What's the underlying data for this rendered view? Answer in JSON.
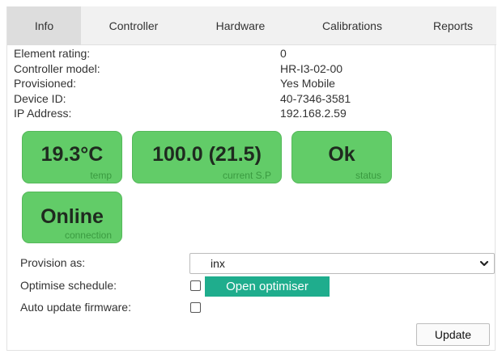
{
  "tabs": [
    {
      "label": "Info",
      "active": true
    },
    {
      "label": "Controller",
      "active": false
    },
    {
      "label": "Hardware",
      "active": false
    },
    {
      "label": "Calibrations",
      "active": false
    },
    {
      "label": "Reports",
      "active": false
    }
  ],
  "info": [
    {
      "label": "Element rating:",
      "value": "0"
    },
    {
      "label": "Controller model:",
      "value": "HR-I3-02-00"
    },
    {
      "label": "Provisioned:",
      "value": "Yes Mobile"
    },
    {
      "label": "Device ID:",
      "value": "40-7346-3581"
    },
    {
      "label": "IP Address:",
      "value": "192.168.2.59"
    }
  ],
  "tiles": {
    "temp": {
      "value": "19.3°C",
      "caption": "temp"
    },
    "current_sp": {
      "value": "100.0 (21.5)",
      "caption": "current S.P"
    },
    "status": {
      "value": "Ok",
      "caption": "status"
    },
    "connection": {
      "value": "Online",
      "caption": "connection"
    }
  },
  "tile_color": "#62cc68",
  "form": {
    "provision_label": "Provision as:",
    "provision_value": "inx",
    "optimise_label": "Optimise schedule:",
    "optimise_checked": false,
    "optimiser_button": "Open optimiser",
    "auto_update_label": "Auto update firmware:",
    "auto_update_checked": false
  },
  "accent_color": "#1fad8d",
  "update_button": "Update"
}
